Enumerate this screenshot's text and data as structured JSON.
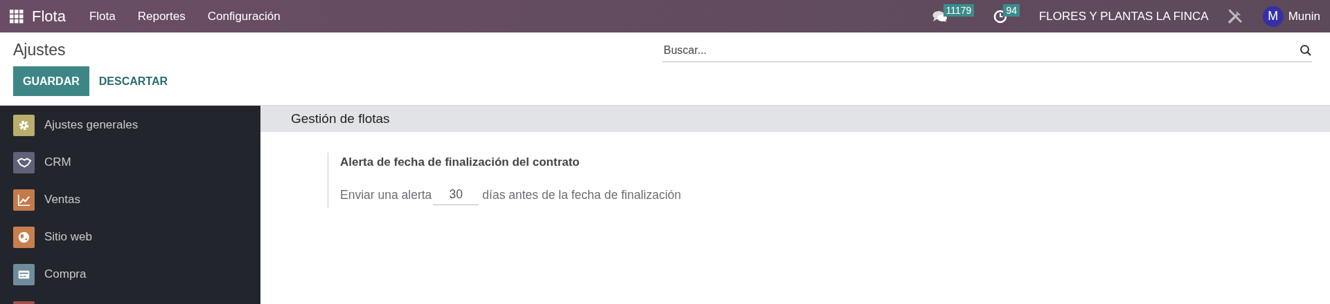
{
  "navbar": {
    "app_name": "Flota",
    "menu": [
      "Flota",
      "Reportes",
      "Configuración"
    ],
    "messages_badge": "11179",
    "activities_badge": "94",
    "company": "FLORES Y PLANTAS LA FINCA",
    "user": {
      "initial": "M",
      "name": "Munin"
    }
  },
  "control_panel": {
    "title": "Ajustes",
    "buttons": [
      "GUARDAR",
      "DESCARTAR"
    ],
    "search": {
      "placeholder": "Buscar..."
    }
  },
  "sidebar": {
    "items": [
      {
        "label": "Ajustes generales",
        "color": "#b9ae6b",
        "selected": false
      },
      {
        "label": "CRM",
        "color": "#5f6278",
        "selected": false
      },
      {
        "label": "Ventas",
        "color": "#c47a4c",
        "selected": false
      },
      {
        "label": "Sitio web",
        "color": "#c77f4e",
        "selected": false
      },
      {
        "label": "Compra",
        "color": "#6f8b9c",
        "selected": false
      },
      {
        "color": "#a04f4f",
        "selected": false
      }
    ]
  },
  "section": {
    "title": "Gestión de flotas",
    "setting": {
      "title": "Alerta de fecha de finalización del contrato",
      "prefix": "Enviar una alerta",
      "value": "30",
      "suffix": "días antes de la fecha de finalización"
    }
  }
}
